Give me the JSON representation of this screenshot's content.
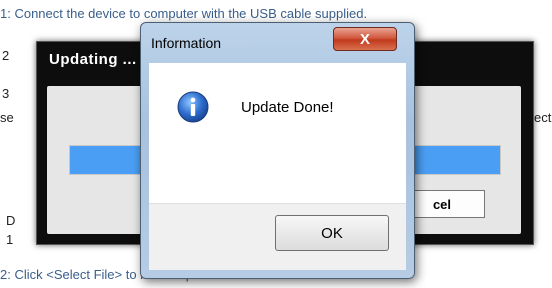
{
  "background": {
    "step1_text": "1: Connect the device to computer with the USB cable supplied.",
    "bottom_text": "2: Click <Select File> to locate update file.",
    "left_fragments": [
      "2",
      "3",
      "se",
      "D",
      "1"
    ],
    "right_fragment": "ect"
  },
  "updating_window": {
    "title": "Updating ...",
    "progress_fraction": 1.0,
    "cancel_label": "cel"
  },
  "info_dialog": {
    "title": "Information",
    "close_label": "X",
    "message": "Update Done!",
    "icon": "info-icon",
    "ok_label": "OK"
  },
  "colors": {
    "link_text": "#3a5f8c",
    "progress": "#4a9ff5",
    "close_button": "#c13a1d",
    "updating_window": "#0d0d0d"
  }
}
